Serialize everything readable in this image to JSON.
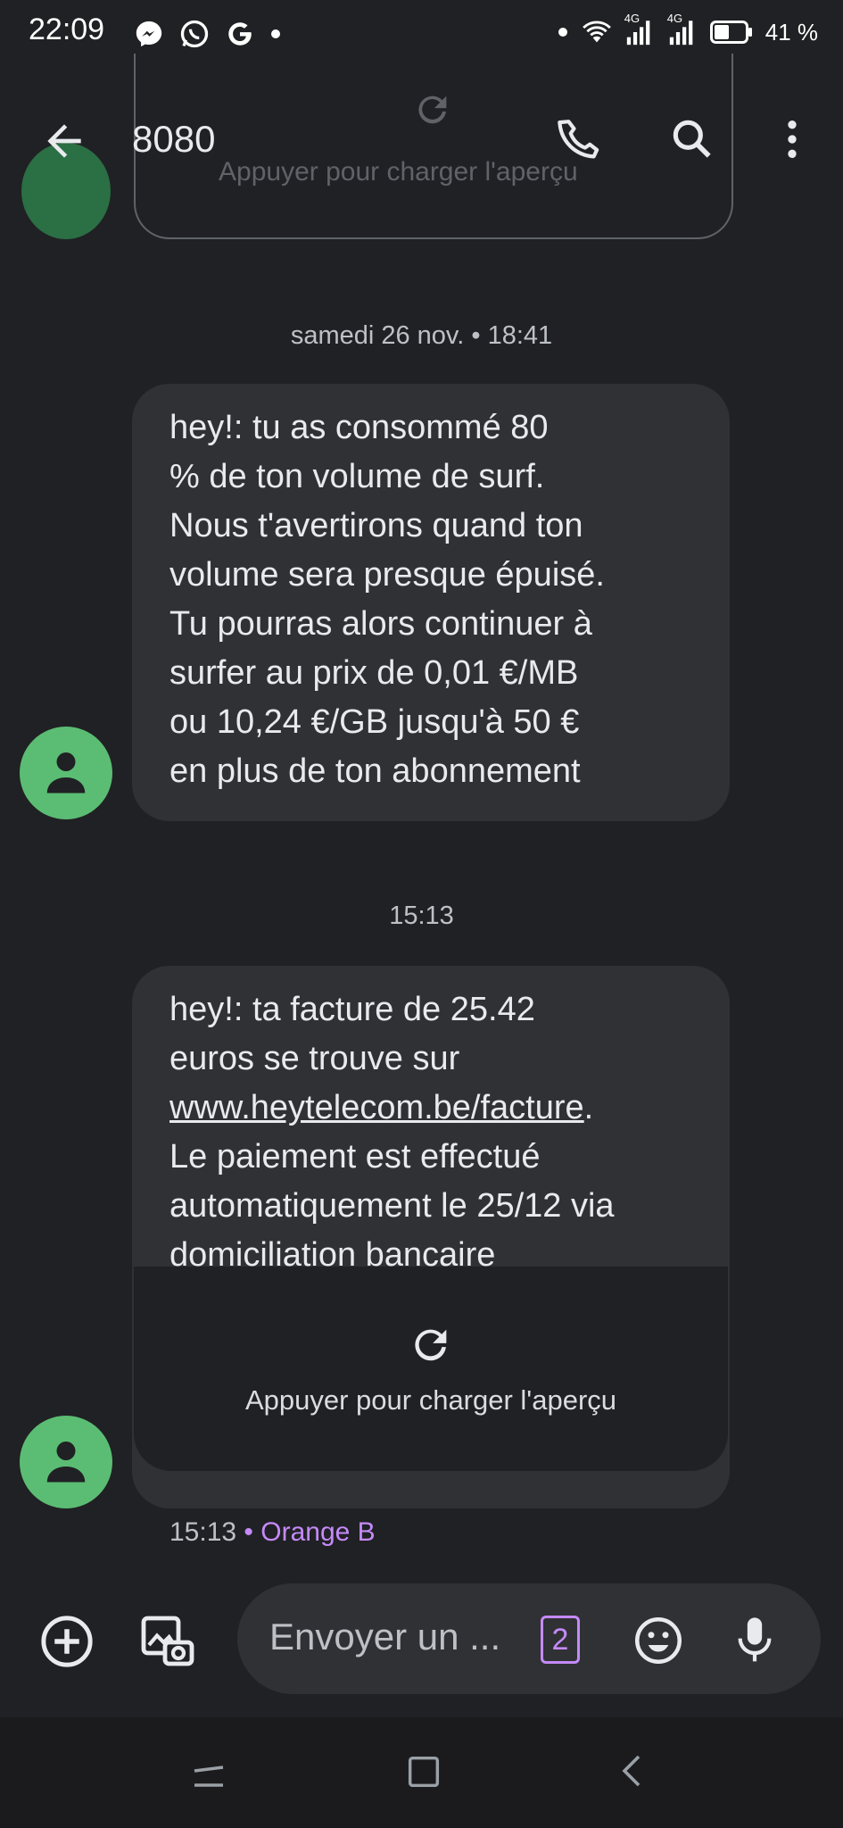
{
  "status_bar": {
    "time": "22:09",
    "battery_percent": "41 %",
    "network_1": "4G",
    "network_2": "4G",
    "notif_icons": [
      "messenger-icon",
      "whatsapp-icon",
      "google-icon",
      "dot-icon"
    ]
  },
  "background_preview": {
    "label": "Appuyer pour charger l'aperçu"
  },
  "toolbar": {
    "title": "8080"
  },
  "messages": [
    {
      "date_separator": "samedi 26 nov. • 18:41",
      "text": "hey!: tu as consommé 80\n% de ton volume de surf.\nNous t'avertirons quand ton\nvolume sera presque épuisé.\nTu pourras alors continuer à\nsurfer au prix de 0,01 €/MB\nou 10,24 €/GB jusqu'à 50 €\nen plus de ton abonnement"
    },
    {
      "date_separator": "15:13",
      "text_part1": "hey!: ta facture de 25.42\neuros se trouve sur\n",
      "link": "www.heytelecom.be/facture",
      "text_part2": ".\nLe paiement est effectué\nautomatiquement le 25/12 via\ndomiciliation bancaire",
      "preview_label": "Appuyer pour charger l'aperçu",
      "meta_time": "15:13",
      "meta_separator": " • ",
      "meta_sim": "Orange B"
    }
  ],
  "composer": {
    "placeholder": "Envoyer un ...",
    "sim_badge": "2"
  },
  "colors": {
    "background": "#202124",
    "bubble": "#303134",
    "avatar": "#5bbd73",
    "accent_sim": "#c58af9"
  }
}
